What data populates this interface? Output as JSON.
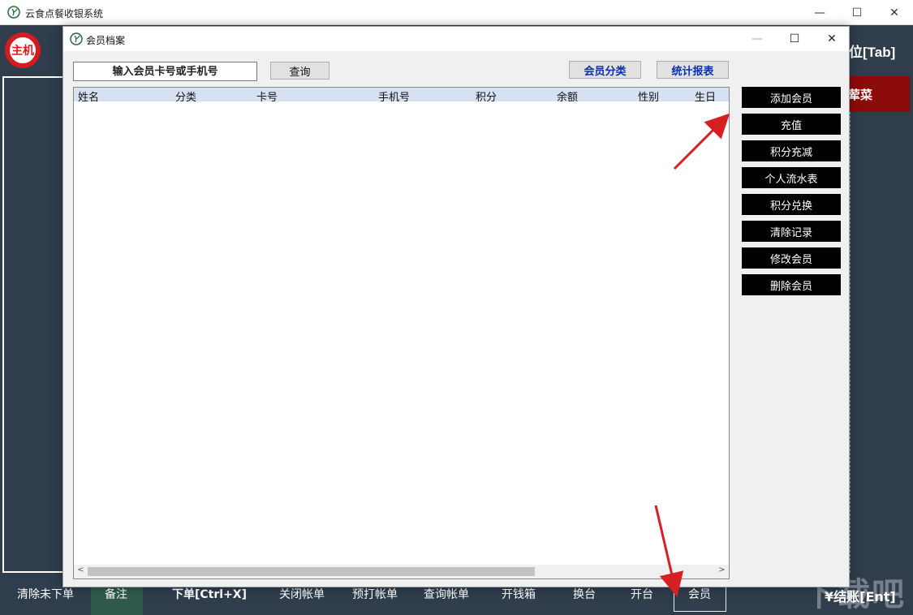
{
  "app": {
    "title": "云食点餐收银系统",
    "host_badge": "主机",
    "right_top_label": "位[Tab]",
    "right_red_label": "荤菜"
  },
  "dialog": {
    "title": "会员档案",
    "search": {
      "placeholder": "输入会员卡号或手机号"
    },
    "query_button": "查询",
    "category_button": "会员分类",
    "report_button": "统计报表",
    "table": {
      "columns": [
        "姓名",
        "分类",
        "卡号",
        "手机号",
        "积分",
        "余额",
        "性别",
        "生日"
      ],
      "rows": []
    },
    "actions": [
      "添加会员",
      "充值",
      "积分充减",
      "个人流水表",
      "积分兑换",
      "清除记录",
      "修改会员",
      "删除会员"
    ]
  },
  "bottom_bar": {
    "items": [
      "清除未下单",
      "备注",
      "下单[Ctrl+X]",
      "关闭帐单",
      "预打帐单",
      "查询帐单",
      "开钱箱",
      "换台",
      "开台",
      "会员"
    ],
    "checkout": "¥结账[Ent]"
  },
  "colors": {
    "background": "#2f3d4c",
    "accent_red": "#8b0a0a",
    "badge_red": "#d71920",
    "action_button": "#000000",
    "table_header": "#d6e1f2",
    "annotation_arrow": "#d42020"
  },
  "watermark": "下载吧"
}
